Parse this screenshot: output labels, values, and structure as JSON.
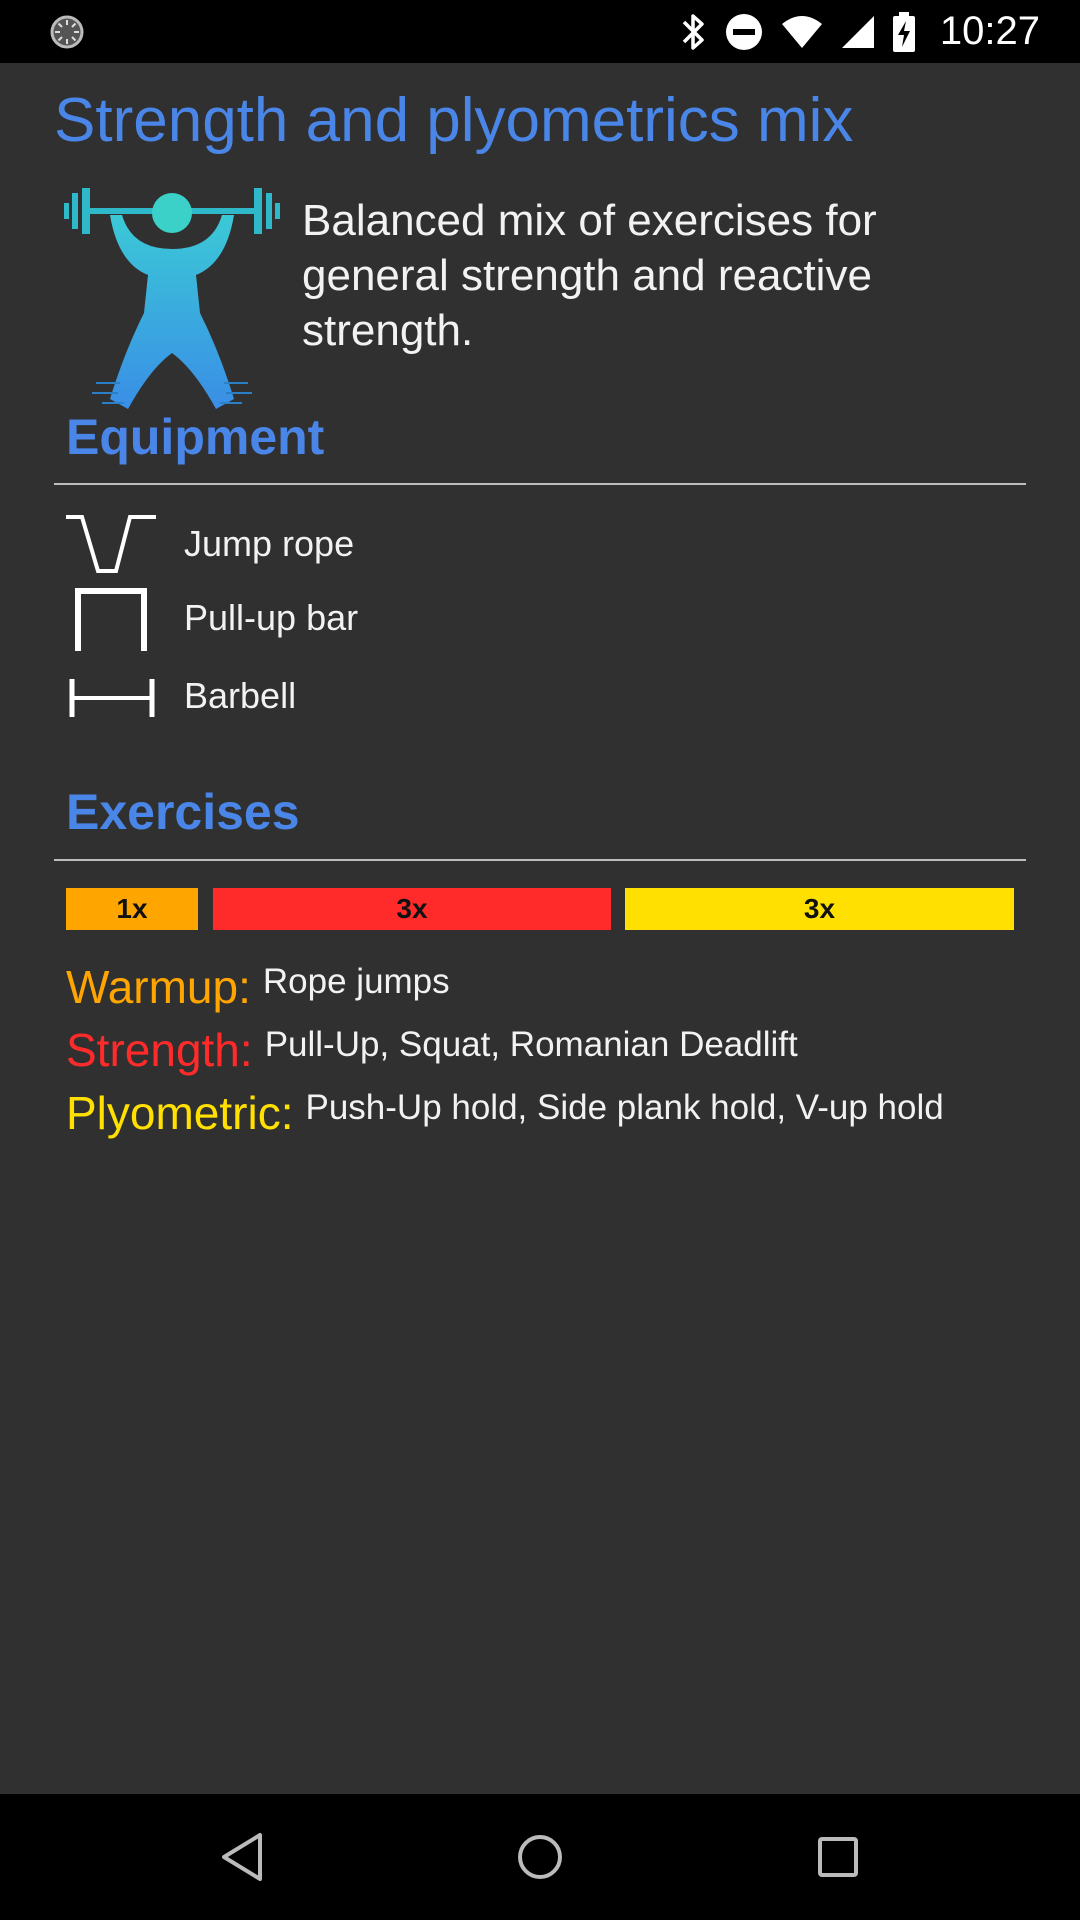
{
  "status_bar": {
    "time": "10:27",
    "icons": [
      "loading-icon",
      "bluetooth-icon",
      "do-not-disturb-icon",
      "wifi-icon",
      "signal-icon",
      "battery-charging-icon"
    ]
  },
  "page": {
    "title": "Strength and plyometrics mix",
    "description": "Balanced mix of exercises for general strength and reactive strength.",
    "header_icon": "weightlifter-icon"
  },
  "equipment": {
    "heading": "Equipment",
    "items": [
      {
        "label": "Jump rope",
        "icon": "jump-rope-icon"
      },
      {
        "label": "Pull-up bar",
        "icon": "pull-up-bar-icon"
      },
      {
        "label": "Barbell",
        "icon": "barbell-icon"
      }
    ]
  },
  "exercises": {
    "heading": "Exercises",
    "bars": [
      {
        "label": "1x",
        "color": "#ffa500"
      },
      {
        "label": "3x",
        "color": "#ff2b2b"
      },
      {
        "label": "3x",
        "color": "#ffe000"
      }
    ],
    "categories": [
      {
        "name": "Warmup:",
        "color": "#ffa500",
        "list": "Rope jumps"
      },
      {
        "name": "Strength:",
        "color": "#ff2b2b",
        "list": "Pull-Up, Squat, Romanian Deadlift"
      },
      {
        "name": "Plyometric:",
        "color": "#ffe000",
        "list": "Push-Up hold, Side plank hold, V-up hold"
      }
    ]
  },
  "nav": {
    "icons": [
      "back-icon",
      "home-icon",
      "recents-icon"
    ]
  },
  "colors": {
    "accent": "#4a86e8",
    "background": "#303030"
  }
}
